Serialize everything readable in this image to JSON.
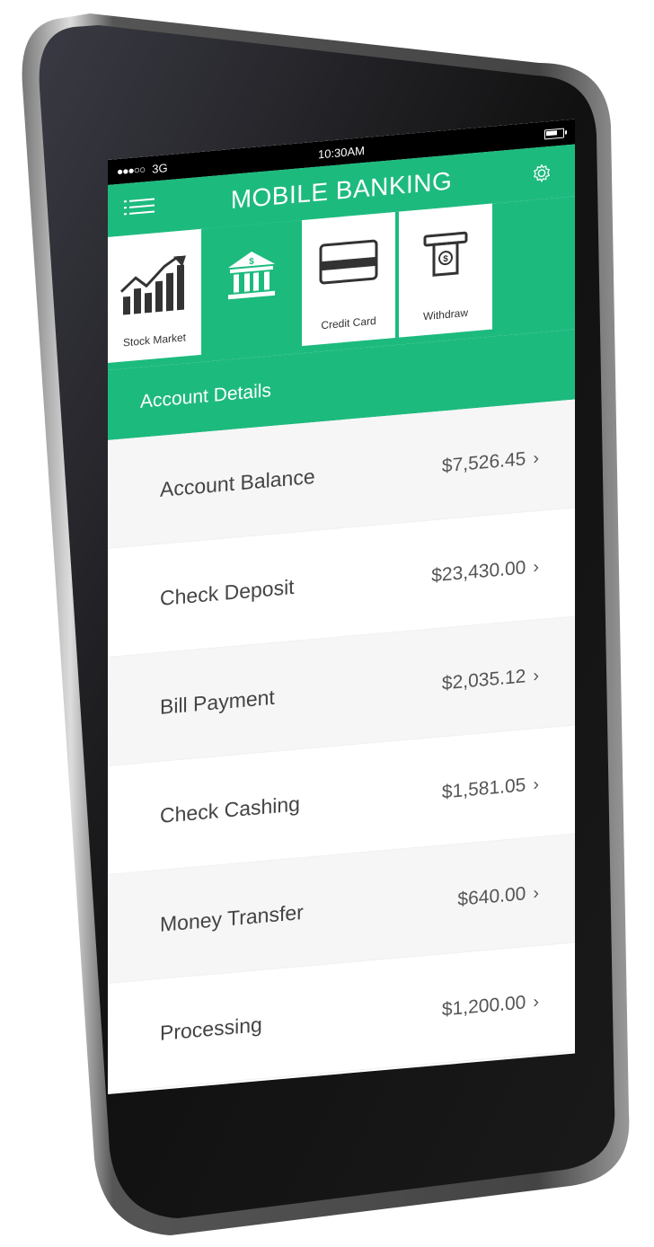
{
  "status_bar": {
    "signal": "●●●○○",
    "network": "3G",
    "time": "10:30AM"
  },
  "header": {
    "title": "MOBILE BANKING",
    "menu_icon": "menu-icon",
    "settings_icon": "gear-icon"
  },
  "tabs": [
    {
      "label": "Stock Market",
      "icon": "chart-icon",
      "active": false
    },
    {
      "label": "",
      "icon": "bank-icon",
      "active": true
    },
    {
      "label": "Credit Card",
      "icon": "credit-card-icon",
      "active": false
    },
    {
      "label": "Withdraw",
      "icon": "atm-icon",
      "active": false
    }
  ],
  "section": {
    "title": "Account Details"
  },
  "accounts": [
    {
      "label": "Account Balance",
      "value": "$7,526.45"
    },
    {
      "label": "Check Deposit",
      "value": "$23,430.00"
    },
    {
      "label": "Bill Payment",
      "value": "$2,035.12"
    },
    {
      "label": "Check Cashing",
      "value": "$1,581.05"
    },
    {
      "label": "Money Transfer",
      "value": "$640.00"
    },
    {
      "label": "Processing",
      "value": "$1,200.00"
    }
  ],
  "colors": {
    "accent": "#1dba7e",
    "phone_body": "#111111"
  }
}
